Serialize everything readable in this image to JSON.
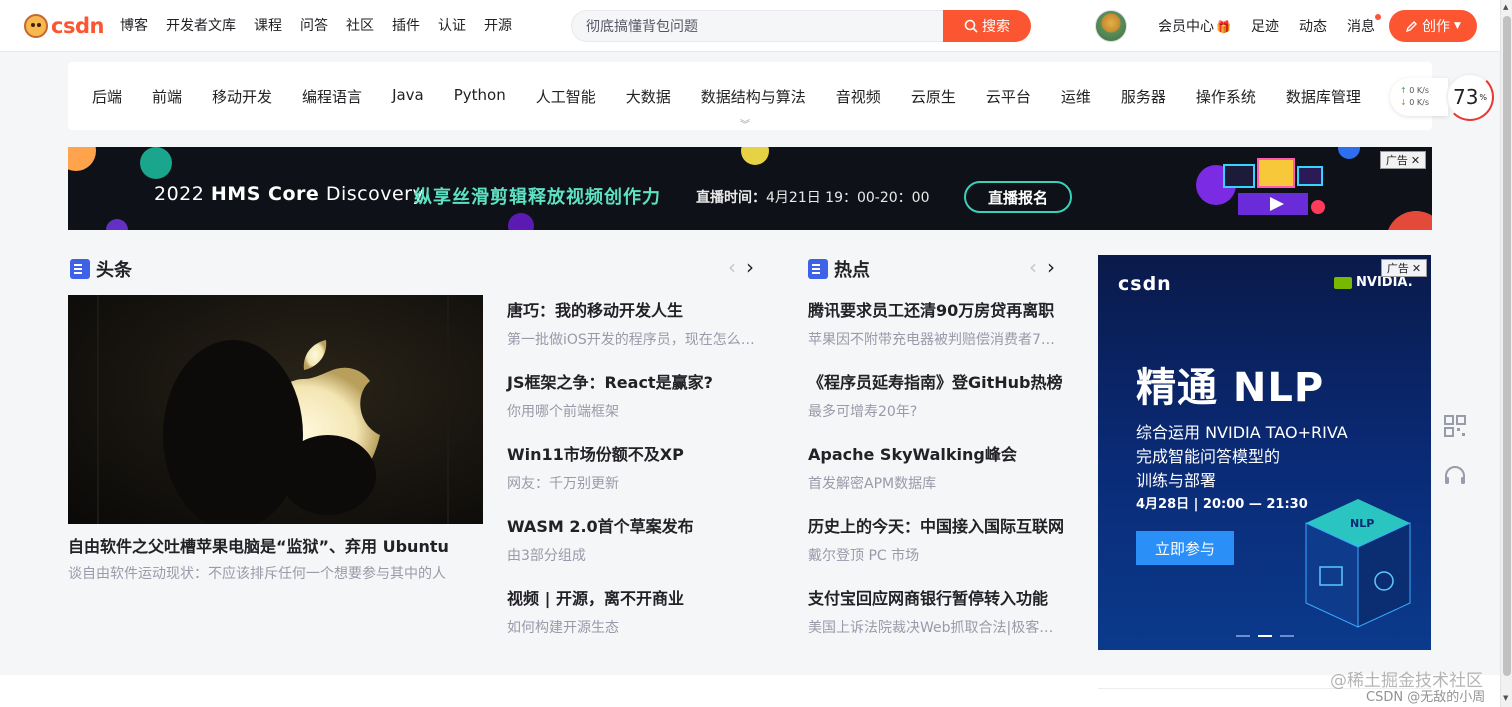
{
  "brand": {
    "logo_text": "CSDN"
  },
  "nav": [
    "博客",
    "开发者文库",
    "课程",
    "问答",
    "社区",
    "插件",
    "认证",
    "开源"
  ],
  "search": {
    "value": "彻底搞懂背包问题",
    "button": "搜索"
  },
  "user_links": {
    "vip": "会员中心",
    "vip_icon": "🎁",
    "footprint": "足迹",
    "dynamic": "动态",
    "messages": "消息"
  },
  "create_button": "创作",
  "categories": [
    "后端",
    "前端",
    "移动开发",
    "编程语言",
    "Java",
    "Python",
    "人工智能",
    "大数据",
    "数据结构与算法",
    "音视频",
    "云原生",
    "云平台",
    "运维",
    "服务器",
    "操作系统",
    "数据库管理"
  ],
  "net_monitor": {
    "up": "0",
    "down": "0",
    "unit": "K/s",
    "percent": "73",
    "percent_sign": "%"
  },
  "banner": {
    "year": "2022",
    "brand_strong": "HMS Core",
    "brand_light": "Discovery",
    "slogan": "纵享丝滑剪辑释放视频创作力",
    "time_label": "直播时间：",
    "time_value": "4月21日 19：00-20：00",
    "cta": "直播报名",
    "ad_label": "广告"
  },
  "headline": {
    "title": "头条",
    "hero_title": "自由软件之父吐槽苹果电脑是“监狱”、弃用 Ubuntu",
    "hero_sub": "谈自由软件运动现状：不应该排斥任何一个想要参与其中的人",
    "items": [
      {
        "title": "唐巧：我的移动开发人生",
        "sub": "第一批做iOS开发的程序员，现在怎么…"
      },
      {
        "title": "JS框架之争：React是赢家?",
        "sub": "你用哪个前端框架"
      },
      {
        "title": "Win11市场份额不及XP",
        "sub": "网友：千万别更新"
      },
      {
        "title": "WASM 2.0首个草案发布",
        "sub": "由3部分组成"
      },
      {
        "title": "视频 | 开源，离不开商业",
        "sub": "如何构建开源生态"
      }
    ]
  },
  "hot": {
    "title": "热点",
    "items": [
      {
        "title": "腾讯要求员工还清90万房贷再离职",
        "sub": "苹果因不附带充电器被判赔偿消费者70…"
      },
      {
        "title": "《程序员延寿指南》登GitHub热榜",
        "sub": "最多可增寿20年?"
      },
      {
        "title": "Apache SkyWalking峰会",
        "sub": "首发解密APM数据库"
      },
      {
        "title": "历史上的今天：中国接入国际互联网",
        "sub": "戴尔登顶 PC 市场"
      },
      {
        "title": "支付宝回应网商银行暂停转入功能",
        "sub": "美国上诉法院裁决Web抓取合法|极客…"
      }
    ]
  },
  "side_ad": {
    "brand": "CSDN",
    "partner": "NVIDIA.",
    "headline": "精通 NLP",
    "line1": "综合运用 NVIDIA TAO+RIVA",
    "line2": "完成智能问答模型的",
    "line3": "训练与部署",
    "date": "4月28日 | 20:00 — 21:30",
    "button": "立即参与",
    "cube_label": "NLP",
    "ad_label": "广告"
  },
  "watermark": {
    "line1": "@稀土掘金技术社区",
    "line2": "CSDN @无敌的小周"
  }
}
